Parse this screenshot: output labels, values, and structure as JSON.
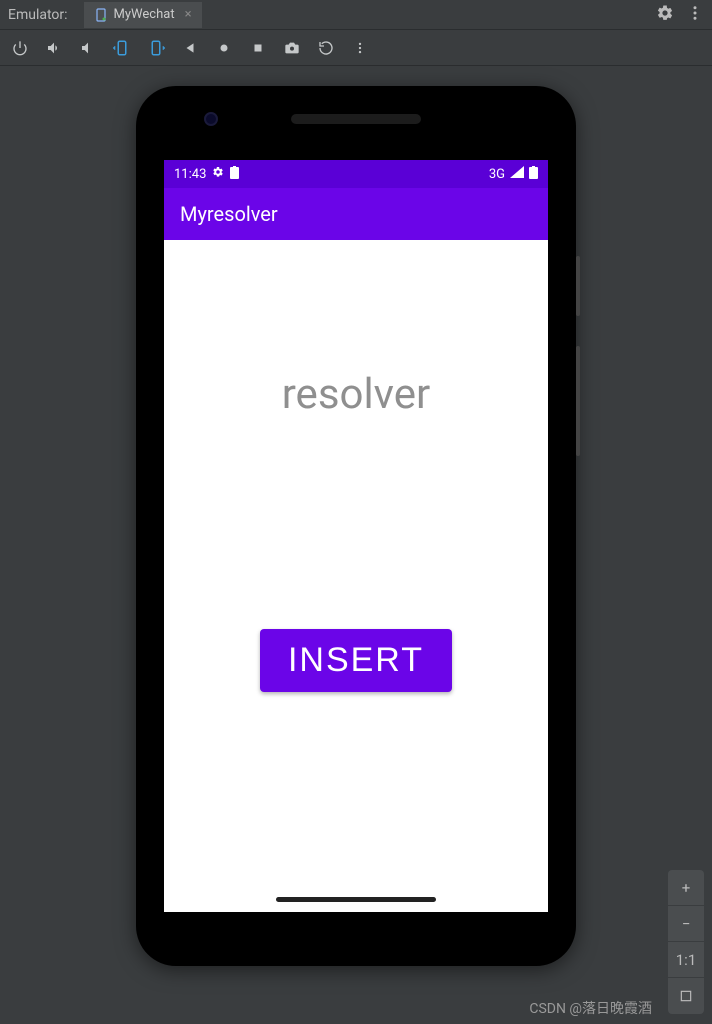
{
  "header": {
    "label": "Emulator:",
    "tab_name": "MyWechat"
  },
  "status_bar": {
    "time": "11:43",
    "network": "3G"
  },
  "app_bar": {
    "title": "Myresolver"
  },
  "content": {
    "text_label": "resolver",
    "button_label": "INSERT"
  },
  "zoom": {
    "plus": "+",
    "minus": "−",
    "oneone": "1:1"
  },
  "watermark": "CSDN @落日晚霞酒"
}
